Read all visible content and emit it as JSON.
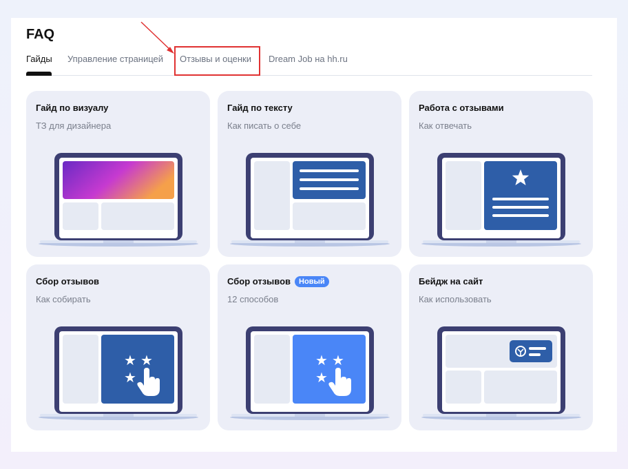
{
  "page": {
    "title": "FAQ",
    "colors": {
      "accent": "#2e5ea8",
      "accent_light": "#4a86f7",
      "highlight": "#e03131",
      "frame": "#3c3f72"
    }
  },
  "tabs": [
    {
      "label": "Гайды",
      "active": true
    },
    {
      "label": "Управление страницей",
      "active": false
    },
    {
      "label": "Отзывы и оценки",
      "active": false,
      "highlighted": true
    },
    {
      "label": "Dream Job на hh.ru",
      "active": false
    }
  ],
  "cards": [
    {
      "title": "Гайд по визуалу",
      "subtitle": "ТЗ для дизайнера",
      "icon": "laptop-gradient-banner-icon"
    },
    {
      "title": "Гайд по тексту",
      "subtitle": "Как писать о себе",
      "icon": "laptop-text-lines-icon"
    },
    {
      "title": "Работа с отзывами",
      "subtitle": "Как отвечать",
      "icon": "laptop-star-review-icon"
    },
    {
      "title": "Сбор отзывов",
      "subtitle": "Как собирать",
      "icon": "laptop-stars-tap-icon"
    },
    {
      "title": "Сбор отзывов",
      "subtitle": "12 способов",
      "badge": "Новый",
      "icon": "laptop-stars-tap-light-icon"
    },
    {
      "title": "Бейдж на сайт",
      "subtitle": "Как использовать",
      "icon": "laptop-site-badge-icon"
    }
  ]
}
